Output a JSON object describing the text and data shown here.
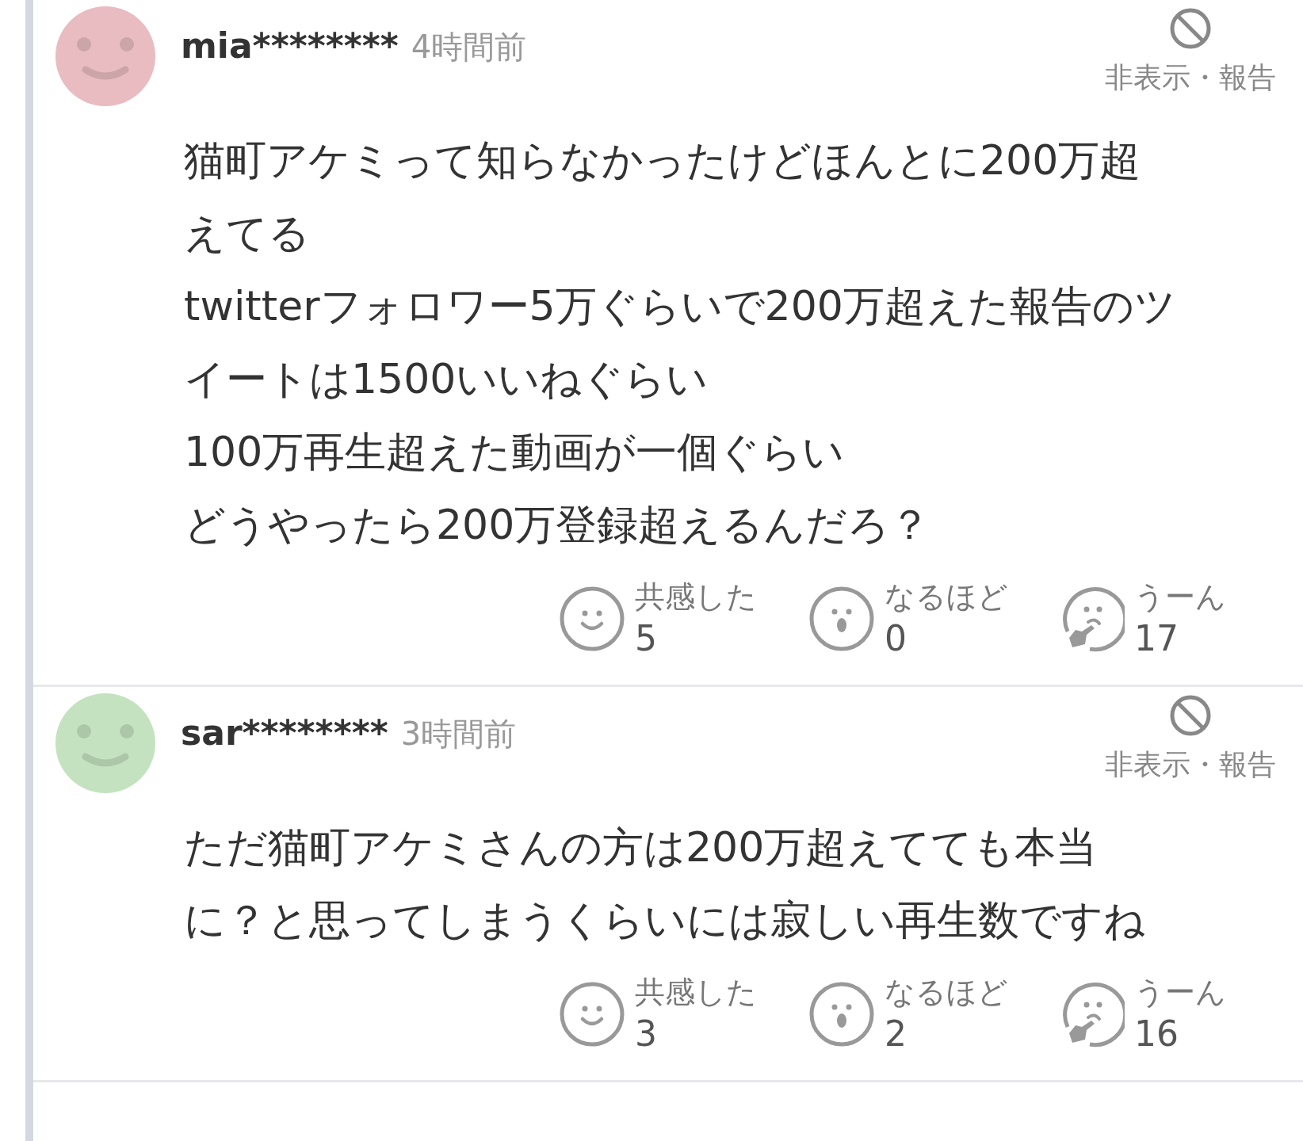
{
  "comments": [
    {
      "user": "mia********",
      "time": "4時間前",
      "avatar": {
        "color": "#e8bcc0"
      },
      "hide_report": "非表示・報告",
      "lines": [
        "猫町アケミって知らなかったけどほんとに200万超",
        "えてる",
        "twitterフォロワー5万ぐらいで200万超えた報告のツ",
        "イートは1500いいねぐらい",
        "100万再生超えた動画が一個ぐらい",
        "どうやったら200万登録超えるんだろ？"
      ],
      "reactions": [
        {
          "kind": "smile",
          "label": "共感した",
          "count": "5"
        },
        {
          "kind": "surprise",
          "label": "なるほど",
          "count": "0"
        },
        {
          "kind": "thinking",
          "label": "うーん",
          "count": "17"
        }
      ]
    },
    {
      "user": "sar********",
      "time": "3時間前",
      "avatar": {
        "color": "#c4e2c0"
      },
      "hide_report": "非表示・報告",
      "lines": [
        "ただ猫町アケミさんの方は200万超えてても本当",
        "に？と思ってしまうくらいには寂しい再生数ですね"
      ],
      "reactions": [
        {
          "kind": "smile",
          "label": "共感した",
          "count": "3"
        },
        {
          "kind": "surprise",
          "label": "なるほど",
          "count": "2"
        },
        {
          "kind": "thinking",
          "label": "うーん",
          "count": "16"
        }
      ]
    }
  ]
}
